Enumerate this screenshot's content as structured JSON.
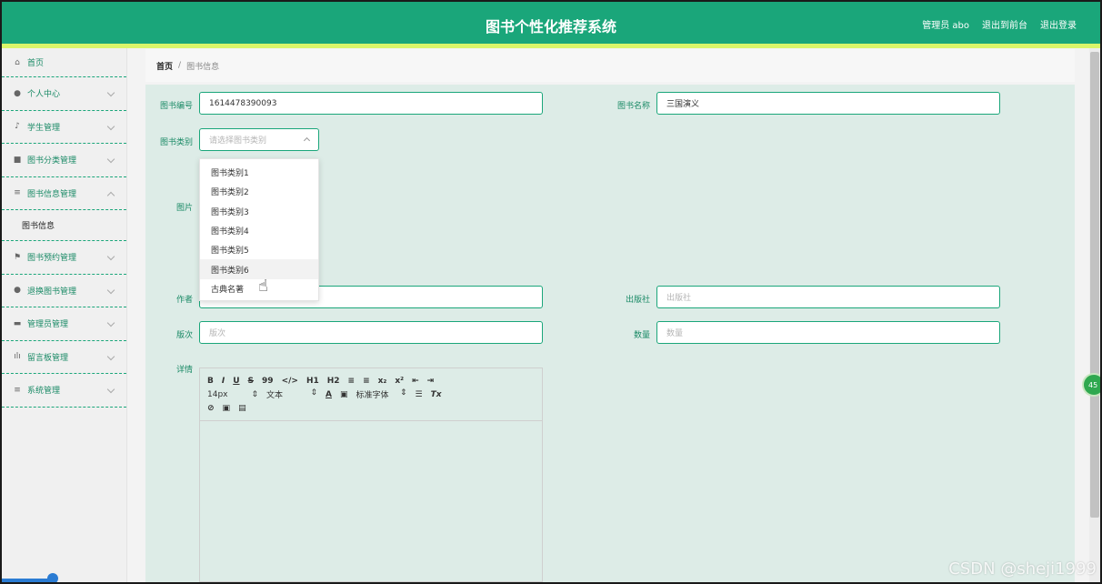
{
  "header": {
    "title": "图书个性化推荐系统",
    "admin": "管理员 abo",
    "back_to_front": "退出到前台",
    "logout": "退出登录",
    "colors": {
      "primary": "#1aa67a",
      "strip": "#d9f56a"
    }
  },
  "sidebar": {
    "items": [
      {
        "label": "首页",
        "icon": "home-icon"
      },
      {
        "label": "个人中心",
        "icon": "user-icon"
      },
      {
        "label": "学生管理",
        "icon": "mic-icon"
      },
      {
        "label": "图书分类管理",
        "icon": "grid-icon"
      },
      {
        "label": "图书信息管理",
        "icon": "list-icon"
      },
      {
        "label": "图书信息",
        "icon": ""
      },
      {
        "label": "图书预约管理",
        "icon": "flag-icon"
      },
      {
        "label": "退换图书管理",
        "icon": "user-icon"
      },
      {
        "label": "管理员管理",
        "icon": "monitor-icon"
      },
      {
        "label": "留言板管理",
        "icon": "bar-chart-icon"
      },
      {
        "label": "系统管理",
        "icon": "list-icon"
      }
    ]
  },
  "breadcrumb": {
    "home": "首页",
    "separator": "/",
    "current": "图书信息"
  },
  "form": {
    "book_no_label": "图书编号",
    "book_no_value": "1614478390093",
    "book_name_label": "图书名称",
    "book_name_value": "三国演义",
    "category_label": "图书类别",
    "category_placeholder": "请选择图书类别",
    "image_label": "图片",
    "author_label": "作者",
    "publisher_label": "出版社",
    "publisher_placeholder": "出版社",
    "edition_label": "版次",
    "edition_placeholder": "版次",
    "quantity_label": "数量",
    "quantity_placeholder": "数量",
    "detail_label": "详情"
  },
  "dropdown": {
    "options": [
      "图书类别1",
      "图书类别2",
      "图书类别3",
      "图书类别4",
      "图书类别5",
      "图书类别6",
      "古典名著"
    ]
  },
  "editor": {
    "row1": [
      "B",
      "I",
      "U",
      "S",
      "99",
      "</>",
      "H1",
      "H2",
      "≡",
      "≡",
      "x₂",
      "x²",
      "⇤",
      "⇥"
    ],
    "size": "14px",
    "text_style": "文本",
    "font": "标准字体"
  },
  "float_badge": "45",
  "watermark": "CSDN @sheji1999"
}
